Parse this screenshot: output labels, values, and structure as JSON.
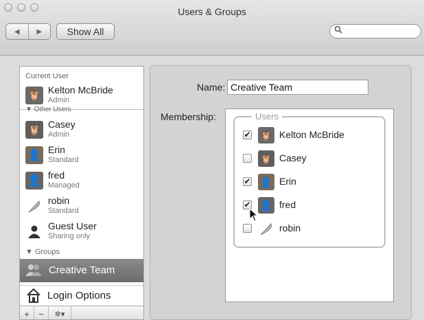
{
  "window": {
    "title": "Users & Groups"
  },
  "toolbar": {
    "back_glyph": "◀",
    "forward_glyph": "▶",
    "show_all": "Show All",
    "search_icon_glyph": "🔍"
  },
  "sidebar": {
    "current_user_header": "Current User",
    "current_user": {
      "name": "Kelton McBride",
      "role": "Admin"
    },
    "other_users_header": "▼ Other Users",
    "users": [
      {
        "name": "Casey",
        "role": "Admin",
        "color": "#5f5f5f"
      },
      {
        "name": "Erin",
        "role": "Standard",
        "color": "#7a6a5a"
      },
      {
        "name": "fred",
        "role": "Managed",
        "color": "#666666"
      },
      {
        "name": "robin",
        "role": "Standard",
        "color": "#ffffff"
      },
      {
        "name": "Guest User",
        "role": "Sharing only",
        "color": "#333333"
      }
    ],
    "groups_header": "▼ Groups",
    "selected_group": "Creative Team",
    "login_options": "Login Options",
    "bottom": {
      "add": "+",
      "remove": "−",
      "gear": "✲▾"
    }
  },
  "detail": {
    "name_label": "Name:",
    "name_value": "Creative Team",
    "membership_label": "Membership:",
    "users_legend": "Users",
    "members": [
      {
        "name": "Kelton McBride",
        "checked": "✔",
        "color": "#6a6a6a"
      },
      {
        "name": "Casey",
        "checked": "",
        "color": "#5f5f5f"
      },
      {
        "name": "Erin",
        "checked": "✔",
        "color": "#7a6a5a"
      },
      {
        "name": "fred",
        "checked": "✔",
        "color": "#666666"
      },
      {
        "name": "robin",
        "checked": "",
        "color": "#ffffff"
      }
    ]
  }
}
